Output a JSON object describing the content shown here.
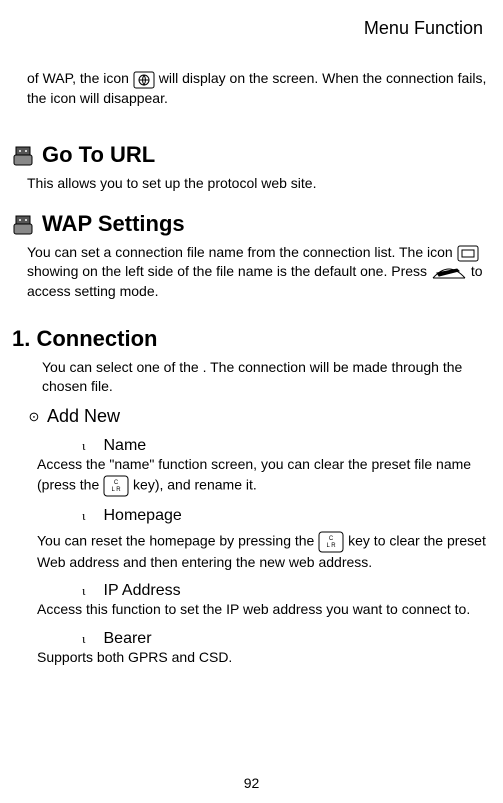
{
  "header": {
    "title": "Menu Function"
  },
  "intro": {
    "part1": "of WAP, the icon",
    "part2": "will display on the screen. When the connection fails, the icon will disappear."
  },
  "go_to_url": {
    "heading": "Go To URL",
    "desc": "This allows you to set up the protocol web site."
  },
  "wap_settings": {
    "heading": "WAP Settings",
    "desc1": "You can set a connection file name from the connection list. The icon",
    "desc2": "showing on the left side of the file name is the default one. Press",
    "desc3": "to access setting mode."
  },
  "connection": {
    "heading": "1. Connection",
    "desc": "You can select one of the . The connection will be made through the chosen file."
  },
  "add_new": {
    "bullet": "⊙",
    "label": "Add New",
    "name": {
      "marker": "ι",
      "label": "Name",
      "desc1": "Access the \"name\" function screen, you can clear the preset file name (press the",
      "desc2": "key), and rename it."
    },
    "homepage": {
      "marker": "ι",
      "label": "Homepage",
      "desc1": "You can reset the homepage by pressing the",
      "desc2": "key to clear the preset Web address and then entering the new web address."
    },
    "ip": {
      "marker": "ι",
      "label": "IP Address",
      "desc": "Access this function to set the IP web address you want to connect to."
    },
    "bearer": {
      "marker": "ι",
      "label": "Bearer",
      "desc": "Supports both GPRS and CSD."
    }
  },
  "page_number": "92"
}
